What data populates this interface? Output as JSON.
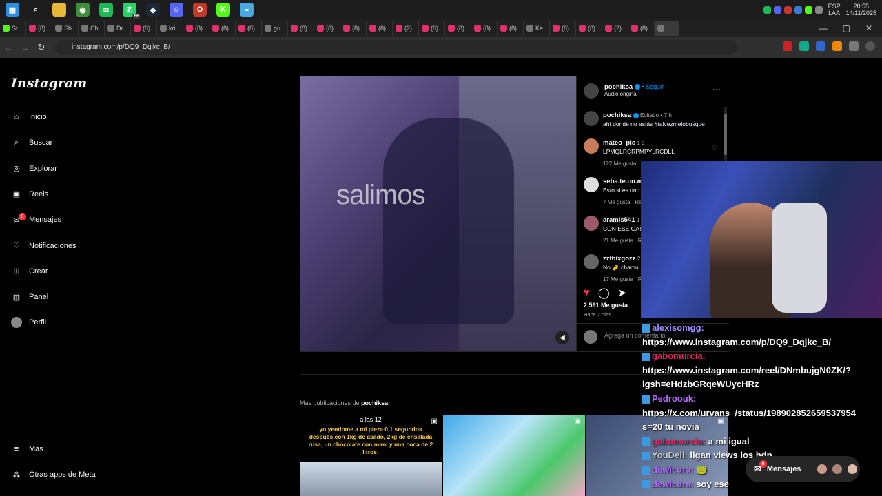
{
  "taskbar": {
    "icons": [
      {
        "name": "windows-start-icon",
        "color": "#2b8fe0",
        "glyph": "▦"
      },
      {
        "name": "search-icon",
        "color": "#1c1c1c",
        "glyph": "⌕"
      },
      {
        "name": "file-explorer-icon",
        "color": "#e8b83a",
        "glyph": ""
      },
      {
        "name": "chrome-icon",
        "color": "#3f8f3a",
        "glyph": "◉"
      },
      {
        "name": "spotify-icon",
        "color": "#1db954",
        "glyph": "≋"
      },
      {
        "name": "whatsapp-icon",
        "color": "#25d366",
        "glyph": "✆"
      },
      {
        "name": "steam-icon",
        "color": "#1b2838",
        "glyph": "◈"
      },
      {
        "name": "discord-icon",
        "color": "#5865f2",
        "glyph": "☺"
      },
      {
        "name": "opera-icon",
        "color": "#c0392b",
        "glyph": "O"
      },
      {
        "name": "kick-icon",
        "color": "#53fc18",
        "glyph": "K"
      },
      {
        "name": "notepad-icon",
        "color": "#4aa8e0",
        "glyph": "≡"
      }
    ],
    "whatsapp_badge": "66",
    "lang_top": "ESP",
    "lang_bottom": "LAA",
    "time": "20:55",
    "date": "14/11/2025"
  },
  "tabs": {
    "items": [
      "St",
      "(8)",
      "Sh",
      "Ch",
      "Dr",
      "(8)",
      "kri",
      "(8)",
      "(8)",
      "(8)",
      "gu",
      "(8)",
      "(8)",
      "(8)",
      "(8)",
      "(2)",
      "(8)",
      "(8)",
      "(8)",
      "(8)",
      "Ke",
      "(8)",
      "(8)",
      "(2)",
      "(8)",
      ""
    ],
    "minimize": "—",
    "maximize": "▢",
    "close": "✕"
  },
  "address": {
    "url": "instagram.com/p/DQ9_Dqjkc_B/"
  },
  "instagram": {
    "logo": "Instagram",
    "nav": [
      {
        "label": "Inicio",
        "icon": "home-icon",
        "glyph": "⌂"
      },
      {
        "label": "Buscar",
        "icon": "search-icon",
        "glyph": "⌕"
      },
      {
        "label": "Explorar",
        "icon": "compass-icon",
        "glyph": "◎"
      },
      {
        "label": "Reels",
        "icon": "reels-icon",
        "glyph": "▣"
      },
      {
        "label": "Mensajes",
        "icon": "messenger-icon",
        "glyph": "✉",
        "badge": "8"
      },
      {
        "label": "Notificaciones",
        "icon": "heart-icon",
        "glyph": "♡"
      },
      {
        "label": "Crear",
        "icon": "plus-square-icon",
        "glyph": "⊞"
      },
      {
        "label": "Panel",
        "icon": "chart-icon",
        "glyph": "▥"
      },
      {
        "label": "Perfil",
        "icon": "profile-avatar",
        "glyph": "●"
      }
    ],
    "more": "Más",
    "meta_apps": "Otras apps de Meta",
    "post": {
      "video_text": "salimos",
      "author": "pochiksa",
      "follow": "Seguir",
      "audio": "Audio original",
      "caption_user": "pochiksa",
      "caption_edited": "Editado",
      "caption_time": "7 h",
      "caption_text": "ahí donde no estás ",
      "caption_tag": "#talvezmelobusque",
      "comments": [
        {
          "user": "mateo_plc",
          "time": "1 d",
          "text": "LPMQLRCRPMPYLRCDLL",
          "likes": "122 Me gusta",
          "reply": "Responder",
          "avatar": "#c77d5a"
        },
        {
          "user": "seba.te.un.ma",
          "time": "",
          "text": "Esto si es und",
          "likes": "7 Me gusta",
          "reply": "Re",
          "avatar": "#ddd"
        },
        {
          "user": "aramis541",
          "time": "1 d",
          "text": "CON ESE GATO",
          "likes": "21 Me gusta",
          "reply": "Re",
          "avatar": "#9a5a6a"
        },
        {
          "user": "zzthixgozz",
          "time": "2 d",
          "text": "No 🤌 chamu",
          "likes": "17 Me gusta",
          "reply": "Re",
          "avatar": "#666"
        }
      ],
      "likes": "2.591 Me gusta",
      "ago": "Hace 2 días",
      "add_comment": "Agrega un comentario..."
    },
    "more_posts_prefix": "Más publicaciones de ",
    "more_posts_user": "pochiksa",
    "thumb1": {
      "title": "a las 12",
      "text": "yo yendome a mi pieza 0,1 segundos después con 1kg de asado, 2kg de ensalada rusa, un chocolate con maní y una coca de 2 litros:"
    },
    "messages_label": "Mensajes",
    "messages_badge": "8"
  },
  "chat": [
    {
      "user": "alexisomgg:",
      "color": "#9b8cff",
      "text": ""
    },
    {
      "user": "",
      "color": "#fff",
      "text": "https://www.instagram.com/p/DQ9_Dqjkc_B/"
    },
    {
      "user": "gabomurcia:",
      "color": "#e0245e",
      "text": ""
    },
    {
      "user": "",
      "color": "#fff",
      "text": "https://www.instagram.com/reel/DNmbujgN0ZK/?"
    },
    {
      "user": "",
      "color": "#fff",
      "text": "igsh=eHdzbGRqeWUycHRz"
    },
    {
      "user": "Pedroouk:",
      "color": "#b26bff",
      "text": ""
    },
    {
      "user": "",
      "color": "#fff",
      "text": "https://x.com/urvans_/status/1989028526595379​54"
    },
    {
      "user": "",
      "color": "#fff",
      "text": "s=20 tu novia"
    },
    {
      "user": "gabomurcia:",
      "color": "#e0245e",
      "text": " a mi igual"
    },
    {
      "user": "YouDell:",
      "color": "#cfcfcf",
      "text": " ligan views los hdp"
    },
    {
      "user": "dewicura:",
      "color": "#b26bff",
      "text": " 🐸"
    },
    {
      "user": "dewicura:",
      "color": "#b26bff",
      "text": " soy ese"
    }
  ]
}
